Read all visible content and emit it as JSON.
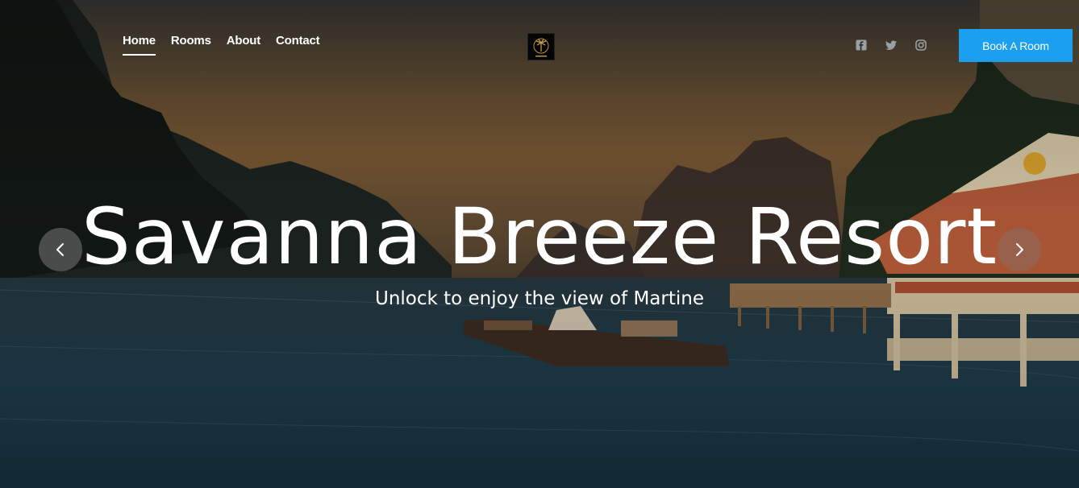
{
  "nav": {
    "items": [
      {
        "label": "Home",
        "active": true
      },
      {
        "label": "Rooms",
        "active": false
      },
      {
        "label": "About",
        "active": false
      },
      {
        "label": "Contact",
        "active": false
      }
    ]
  },
  "logo_icon": "palm-tree-logo-icon",
  "social": [
    "facebook-icon",
    "twitter-icon",
    "instagram-icon"
  ],
  "book_button": {
    "label": "Book A Room",
    "color": "#1b9ff0"
  },
  "hero": {
    "title": "Savanna Breeze Resort",
    "subtitle": "Unlock to enjoy the view of Martine"
  },
  "carousel": {
    "prev_icon": "chevron-left-icon",
    "next_icon": "chevron-right-icon"
  }
}
